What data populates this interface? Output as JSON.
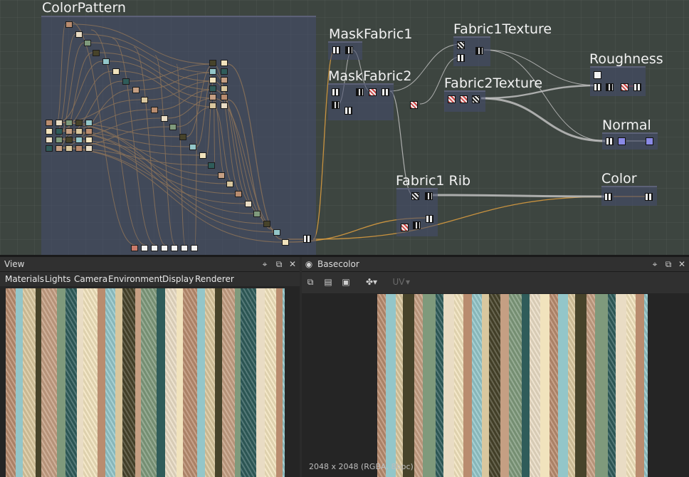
{
  "graph": {
    "frames": {
      "color_pattern": "ColorPattern",
      "mask_fabric1": "MaskFabric1",
      "mask_fabric2": "MaskFabric2",
      "fabric1_texture": "Fabric1Texture",
      "fabric2_texture": "Fabric2Texture",
      "roughness": "Roughness",
      "normal": "Normal",
      "fabric1_rib": "Fabric1 Rib",
      "color": "Color"
    },
    "colors": {
      "wire_orange": "#e0a040",
      "wire_gray": "#bfbfbf",
      "frame_fill": "#4a5070"
    }
  },
  "view_panel": {
    "title": "View",
    "menu": [
      "Materials",
      "Lights",
      "Camera",
      "Environment",
      "Display",
      "Renderer"
    ],
    "icons": [
      "pin-icon",
      "restore-icon",
      "close-icon"
    ]
  },
  "basecolor_panel": {
    "title": "Basecolor",
    "toolbar_mode": "UV",
    "status": "2048 x 2048 (RGBA, 8bpc)",
    "icons": [
      "pin-icon",
      "restore-icon",
      "close-icon",
      "copy-icon",
      "save-icon",
      "camera-icon",
      "share-icon"
    ]
  },
  "stripe_palette": [
    "#b98c6f",
    "#e9dcc4",
    "#7f9a7c",
    "#47432a",
    "#93c6c9",
    "#f1e3bd",
    "#2f5c5a",
    "#c59f83",
    "#d9c79e"
  ]
}
